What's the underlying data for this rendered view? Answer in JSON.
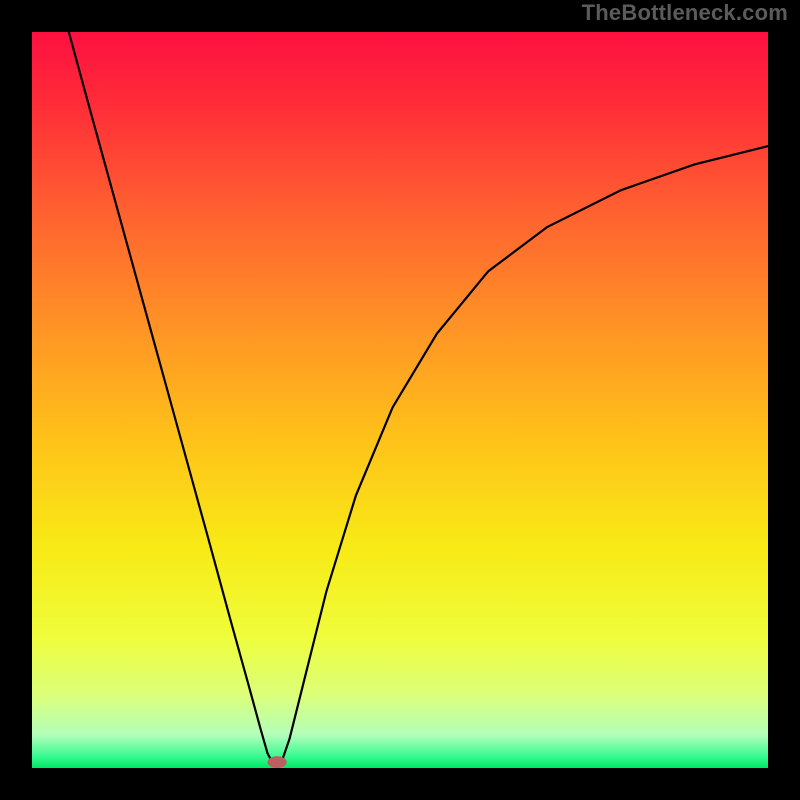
{
  "watermark": "TheBottleneck.com",
  "colors": {
    "frame": "#000000",
    "curve": "#000000",
    "marker_fill": "#bd5f61"
  },
  "chart_data": {
    "type": "line",
    "title": "",
    "xlabel": "",
    "ylabel": "",
    "xlim": [
      0,
      100
    ],
    "ylim": [
      0,
      100
    ],
    "gradient_stops": [
      {
        "offset": 0.0,
        "color": "#fd1040"
      },
      {
        "offset": 0.1,
        "color": "#ff2d38"
      },
      {
        "offset": 0.25,
        "color": "#ff6330"
      },
      {
        "offset": 0.4,
        "color": "#ff9325"
      },
      {
        "offset": 0.55,
        "color": "#ffc119"
      },
      {
        "offset": 0.7,
        "color": "#f8ea16"
      },
      {
        "offset": 0.82,
        "color": "#effd3a"
      },
      {
        "offset": 0.9,
        "color": "#dcff79"
      },
      {
        "offset": 0.955,
        "color": "#b3ffba"
      },
      {
        "offset": 0.985,
        "color": "#36f98f"
      },
      {
        "offset": 1.0,
        "color": "#00e765"
      }
    ],
    "series": [
      {
        "name": "left-branch",
        "x": [
          5.0,
          8.0,
          12.0,
          16.0,
          20.0,
          24.0,
          27.0,
          29.5,
          31.0,
          32.0,
          32.8
        ],
        "y": [
          100.0,
          89.0,
          74.5,
          60.0,
          45.5,
          31.0,
          20.0,
          11.0,
          5.5,
          2.0,
          0.5
        ]
      },
      {
        "name": "right-branch",
        "x": [
          33.8,
          35.0,
          37.0,
          40.0,
          44.0,
          49.0,
          55.0,
          62.0,
          70.0,
          80.0,
          90.0,
          100.0
        ],
        "y": [
          0.5,
          4.0,
          12.0,
          24.0,
          37.0,
          49.0,
          59.0,
          67.5,
          73.5,
          78.5,
          82.0,
          84.5
        ]
      }
    ],
    "marker": {
      "x": 33.3,
      "y": 0.8,
      "rx": 1.3,
      "ry": 0.8
    }
  }
}
